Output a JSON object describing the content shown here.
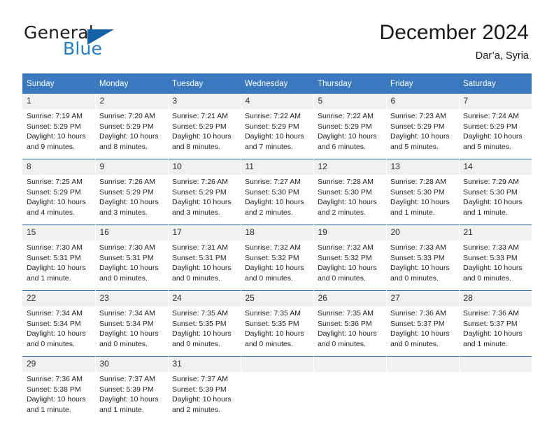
{
  "brand": {
    "name_part1": "General",
    "name_part2": "Blue",
    "triangle_color": "#1362a8",
    "blue_color": "#1f7ec4"
  },
  "header": {
    "title": "December 2024",
    "location": "Dar’a, Syria"
  },
  "theme": {
    "header_bg": "#3a79bf",
    "header_text": "#ffffff",
    "daynum_bg": "#f0f0f0",
    "row_divider": "#2d6eb5"
  },
  "weekdays": [
    "Sunday",
    "Monday",
    "Tuesday",
    "Wednesday",
    "Thursday",
    "Friday",
    "Saturday"
  ],
  "weeks": [
    [
      {
        "day": "1",
        "sunrise": "Sunrise: 7:19 AM",
        "sunset": "Sunset: 5:29 PM",
        "daylight1": "Daylight: 10 hours",
        "daylight2": "and 9 minutes."
      },
      {
        "day": "2",
        "sunrise": "Sunrise: 7:20 AM",
        "sunset": "Sunset: 5:29 PM",
        "daylight1": "Daylight: 10 hours",
        "daylight2": "and 8 minutes."
      },
      {
        "day": "3",
        "sunrise": "Sunrise: 7:21 AM",
        "sunset": "Sunset: 5:29 PM",
        "daylight1": "Daylight: 10 hours",
        "daylight2": "and 8 minutes."
      },
      {
        "day": "4",
        "sunrise": "Sunrise: 7:22 AM",
        "sunset": "Sunset: 5:29 PM",
        "daylight1": "Daylight: 10 hours",
        "daylight2": "and 7 minutes."
      },
      {
        "day": "5",
        "sunrise": "Sunrise: 7:22 AM",
        "sunset": "Sunset: 5:29 PM",
        "daylight1": "Daylight: 10 hours",
        "daylight2": "and 6 minutes."
      },
      {
        "day": "6",
        "sunrise": "Sunrise: 7:23 AM",
        "sunset": "Sunset: 5:29 PM",
        "daylight1": "Daylight: 10 hours",
        "daylight2": "and 5 minutes."
      },
      {
        "day": "7",
        "sunrise": "Sunrise: 7:24 AM",
        "sunset": "Sunset: 5:29 PM",
        "daylight1": "Daylight: 10 hours",
        "daylight2": "and 5 minutes."
      }
    ],
    [
      {
        "day": "8",
        "sunrise": "Sunrise: 7:25 AM",
        "sunset": "Sunset: 5:29 PM",
        "daylight1": "Daylight: 10 hours",
        "daylight2": "and 4 minutes."
      },
      {
        "day": "9",
        "sunrise": "Sunrise: 7:26 AM",
        "sunset": "Sunset: 5:29 PM",
        "daylight1": "Daylight: 10 hours",
        "daylight2": "and 3 minutes."
      },
      {
        "day": "10",
        "sunrise": "Sunrise: 7:26 AM",
        "sunset": "Sunset: 5:29 PM",
        "daylight1": "Daylight: 10 hours",
        "daylight2": "and 3 minutes."
      },
      {
        "day": "11",
        "sunrise": "Sunrise: 7:27 AM",
        "sunset": "Sunset: 5:30 PM",
        "daylight1": "Daylight: 10 hours",
        "daylight2": "and 2 minutes."
      },
      {
        "day": "12",
        "sunrise": "Sunrise: 7:28 AM",
        "sunset": "Sunset: 5:30 PM",
        "daylight1": "Daylight: 10 hours",
        "daylight2": "and 2 minutes."
      },
      {
        "day": "13",
        "sunrise": "Sunrise: 7:28 AM",
        "sunset": "Sunset: 5:30 PM",
        "daylight1": "Daylight: 10 hours",
        "daylight2": "and 1 minute."
      },
      {
        "day": "14",
        "sunrise": "Sunrise: 7:29 AM",
        "sunset": "Sunset: 5:30 PM",
        "daylight1": "Daylight: 10 hours",
        "daylight2": "and 1 minute."
      }
    ],
    [
      {
        "day": "15",
        "sunrise": "Sunrise: 7:30 AM",
        "sunset": "Sunset: 5:31 PM",
        "daylight1": "Daylight: 10 hours",
        "daylight2": "and 1 minute."
      },
      {
        "day": "16",
        "sunrise": "Sunrise: 7:30 AM",
        "sunset": "Sunset: 5:31 PM",
        "daylight1": "Daylight: 10 hours",
        "daylight2": "and 0 minutes."
      },
      {
        "day": "17",
        "sunrise": "Sunrise: 7:31 AM",
        "sunset": "Sunset: 5:31 PM",
        "daylight1": "Daylight: 10 hours",
        "daylight2": "and 0 minutes."
      },
      {
        "day": "18",
        "sunrise": "Sunrise: 7:32 AM",
        "sunset": "Sunset: 5:32 PM",
        "daylight1": "Daylight: 10 hours",
        "daylight2": "and 0 minutes."
      },
      {
        "day": "19",
        "sunrise": "Sunrise: 7:32 AM",
        "sunset": "Sunset: 5:32 PM",
        "daylight1": "Daylight: 10 hours",
        "daylight2": "and 0 minutes."
      },
      {
        "day": "20",
        "sunrise": "Sunrise: 7:33 AM",
        "sunset": "Sunset: 5:33 PM",
        "daylight1": "Daylight: 10 hours",
        "daylight2": "and 0 minutes."
      },
      {
        "day": "21",
        "sunrise": "Sunrise: 7:33 AM",
        "sunset": "Sunset: 5:33 PM",
        "daylight1": "Daylight: 10 hours",
        "daylight2": "and 0 minutes."
      }
    ],
    [
      {
        "day": "22",
        "sunrise": "Sunrise: 7:34 AM",
        "sunset": "Sunset: 5:34 PM",
        "daylight1": "Daylight: 10 hours",
        "daylight2": "and 0 minutes."
      },
      {
        "day": "23",
        "sunrise": "Sunrise: 7:34 AM",
        "sunset": "Sunset: 5:34 PM",
        "daylight1": "Daylight: 10 hours",
        "daylight2": "and 0 minutes."
      },
      {
        "day": "24",
        "sunrise": "Sunrise: 7:35 AM",
        "sunset": "Sunset: 5:35 PM",
        "daylight1": "Daylight: 10 hours",
        "daylight2": "and 0 minutes."
      },
      {
        "day": "25",
        "sunrise": "Sunrise: 7:35 AM",
        "sunset": "Sunset: 5:35 PM",
        "daylight1": "Daylight: 10 hours",
        "daylight2": "and 0 minutes."
      },
      {
        "day": "26",
        "sunrise": "Sunrise: 7:35 AM",
        "sunset": "Sunset: 5:36 PM",
        "daylight1": "Daylight: 10 hours",
        "daylight2": "and 0 minutes."
      },
      {
        "day": "27",
        "sunrise": "Sunrise: 7:36 AM",
        "sunset": "Sunset: 5:37 PM",
        "daylight1": "Daylight: 10 hours",
        "daylight2": "and 0 minutes."
      },
      {
        "day": "28",
        "sunrise": "Sunrise: 7:36 AM",
        "sunset": "Sunset: 5:37 PM",
        "daylight1": "Daylight: 10 hours",
        "daylight2": "and 1 minute."
      }
    ],
    [
      {
        "day": "29",
        "sunrise": "Sunrise: 7:36 AM",
        "sunset": "Sunset: 5:38 PM",
        "daylight1": "Daylight: 10 hours",
        "daylight2": "and 1 minute."
      },
      {
        "day": "30",
        "sunrise": "Sunrise: 7:37 AM",
        "sunset": "Sunset: 5:39 PM",
        "daylight1": "Daylight: 10 hours",
        "daylight2": "and 1 minute."
      },
      {
        "day": "31",
        "sunrise": "Sunrise: 7:37 AM",
        "sunset": "Sunset: 5:39 PM",
        "daylight1": "Daylight: 10 hours",
        "daylight2": "and 2 minutes."
      },
      {
        "day": "",
        "sunrise": "",
        "sunset": "",
        "daylight1": "",
        "daylight2": ""
      },
      {
        "day": "",
        "sunrise": "",
        "sunset": "",
        "daylight1": "",
        "daylight2": ""
      },
      {
        "day": "",
        "sunrise": "",
        "sunset": "",
        "daylight1": "",
        "daylight2": ""
      },
      {
        "day": "",
        "sunrise": "",
        "sunset": "",
        "daylight1": "",
        "daylight2": ""
      }
    ]
  ]
}
